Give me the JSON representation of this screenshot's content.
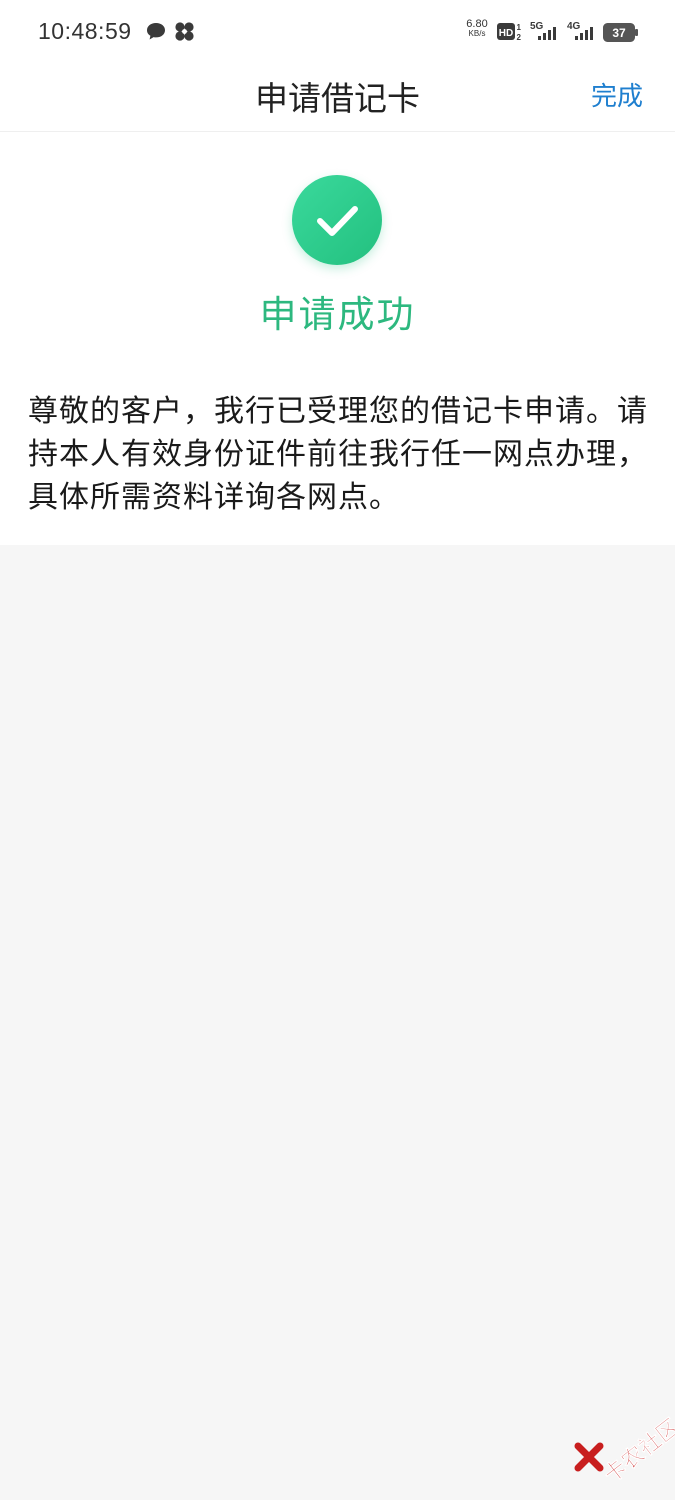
{
  "status_bar": {
    "time": "10:48:59",
    "net_speed_value": "6.80",
    "net_speed_unit": "KB/s",
    "hd_label": "HD",
    "sim1_label": "5G",
    "sim2_label": "4G",
    "battery": "37",
    "icons": [
      "chat-bubble-icon",
      "fan-icon",
      "hd-voice-icon",
      "signal-5g-icon",
      "signal-4g-icon",
      "battery-icon"
    ]
  },
  "nav": {
    "title": "申请借记卡",
    "done_label": "完成"
  },
  "result": {
    "icon": "check-circle-icon",
    "status_text": "申请成功",
    "message": "尊敬的客户，我行已受理您的借记卡申请。请持本人有效身份证件前往我行任一网点办理，具体所需资料详询各网点。"
  },
  "colors": {
    "success_green": "#2db87f",
    "link_blue": "#1f7fcf",
    "page_bg": "#f6f6f6"
  },
  "watermark": {
    "text": "卡农社区"
  }
}
